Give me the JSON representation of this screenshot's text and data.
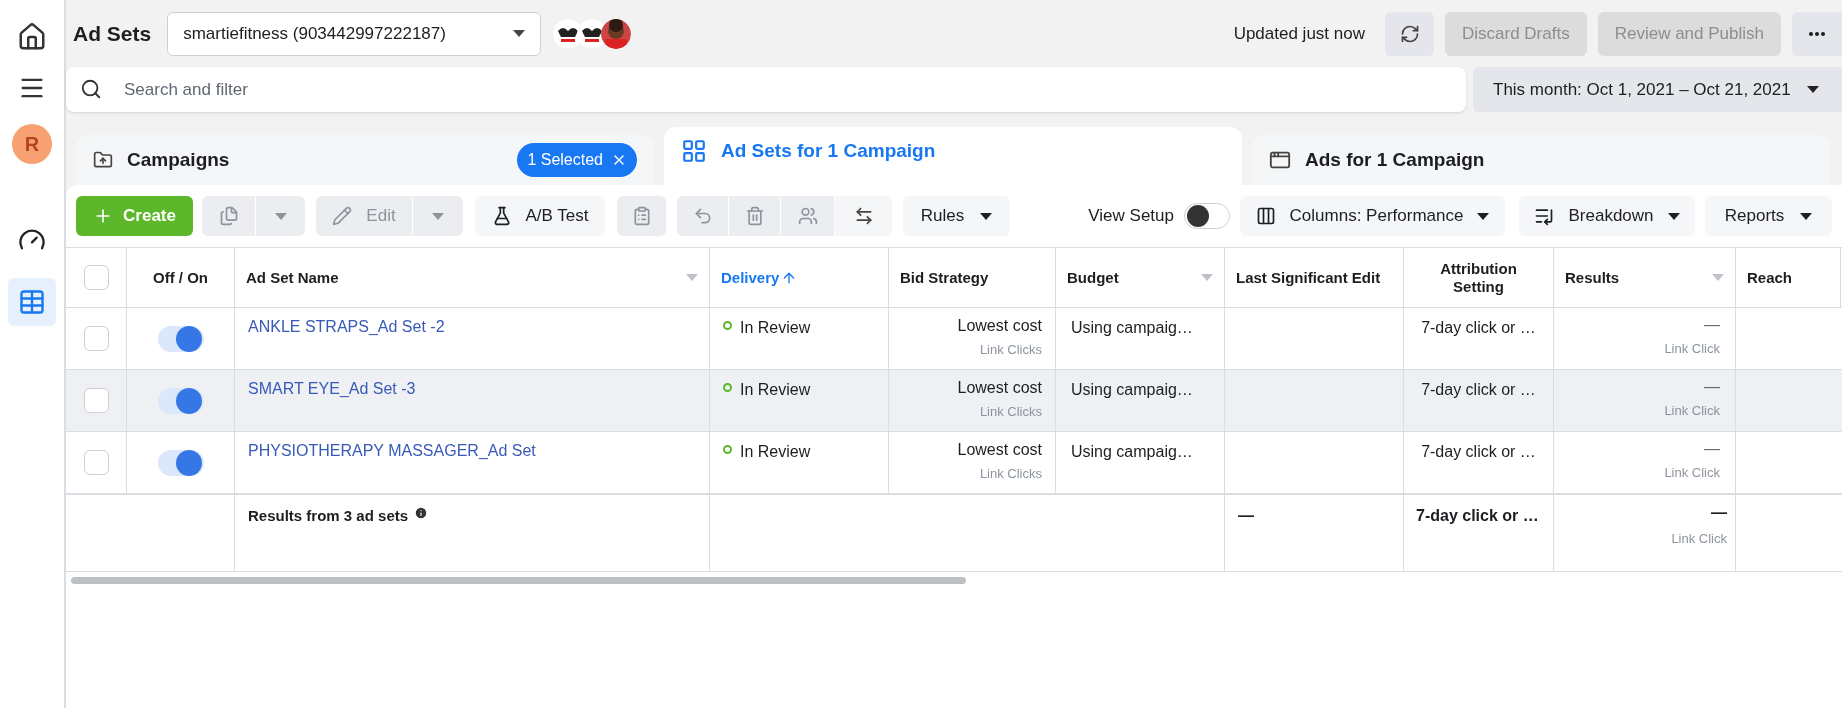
{
  "sidebar": {
    "avatar": "R",
    "items": [
      {
        "kind": "dashboard",
        "selected": false
      },
      {
        "kind": "table",
        "selected": true
      }
    ]
  },
  "header": {
    "title": "Ad Sets",
    "account": "smartiefitness (903442997222187)",
    "status": "Updated just now",
    "buttons": [
      {
        "label": "Discard Drafts",
        "disabled": true
      },
      {
        "label": "Review and Publish",
        "disabled": true
      }
    ]
  },
  "search": {
    "placeholder": "Search and filter"
  },
  "date_range": "This month: Oct 1, 2021 – Oct 21, 2021",
  "tabs": [
    {
      "kind": "campaigns",
      "label": "Campaigns",
      "selected": false,
      "badge": "1 Selected"
    },
    {
      "kind": "adsets",
      "label": "Ad Sets for 1 Campaign",
      "selected": true
    },
    {
      "kind": "ads",
      "label": "Ads for 1 Campaign",
      "selected": false
    }
  ],
  "toolbar": {
    "create": "Create",
    "edit": "Edit",
    "ab_test": "A/B Test",
    "rules": "Rules",
    "view_setup": {
      "label": "View Setup",
      "on": false
    },
    "columns": "Columns: Performance",
    "breakdown": "Breakdown",
    "reports": "Reports"
  },
  "table": {
    "header_checked": false,
    "columns": [
      {
        "label": "Off / On",
        "kind": "plain"
      },
      {
        "label": "Ad Set Name",
        "kind": "menu"
      },
      {
        "label": "Delivery",
        "kind": "sorted"
      },
      {
        "label": "Bid Strategy",
        "kind": "plain"
      },
      {
        "label": "Budget",
        "kind": "menu"
      },
      {
        "label": "Last Significant Edit",
        "kind": "plain"
      },
      {
        "label": "Attribution Setting",
        "kind": "plain"
      },
      {
        "label": "Results",
        "kind": "menu"
      },
      {
        "label": "Reach",
        "kind": "plain"
      }
    ],
    "rows": [
      {
        "checked": false,
        "on": true,
        "highlighted": false,
        "name": "ANKLE STRAPS_Ad Set -2",
        "delivery": "In Review",
        "bid": "Lowest cost",
        "bid_sub": "Link Clicks",
        "budget": "Using campaig…",
        "attribution": "7-day click or …",
        "results": "—",
        "results_sub": "Link Click"
      },
      {
        "checked": false,
        "on": true,
        "highlighted": true,
        "name": "SMART EYE_Ad Set -3",
        "delivery": "In Review",
        "bid": "Lowest cost",
        "bid_sub": "Link Clicks",
        "budget": "Using campaig…",
        "attribution": "7-day click or …",
        "results": "—",
        "results_sub": "Link Click"
      },
      {
        "checked": false,
        "on": true,
        "highlighted": false,
        "name": "PHYSIOTHERAPY MASSAGER_Ad Set",
        "delivery": "In Review",
        "bid": "Lowest cost",
        "bid_sub": "Link Clicks",
        "budget": "Using campaig…",
        "attribution": "7-day click or …",
        "results": "—",
        "results_sub": "Link Click"
      }
    ],
    "summary": {
      "label": "Results from 3 ad sets",
      "last_edit": "—",
      "attribution": "7-day click or …",
      "results": "—",
      "results_sub": "Link Click"
    }
  }
}
